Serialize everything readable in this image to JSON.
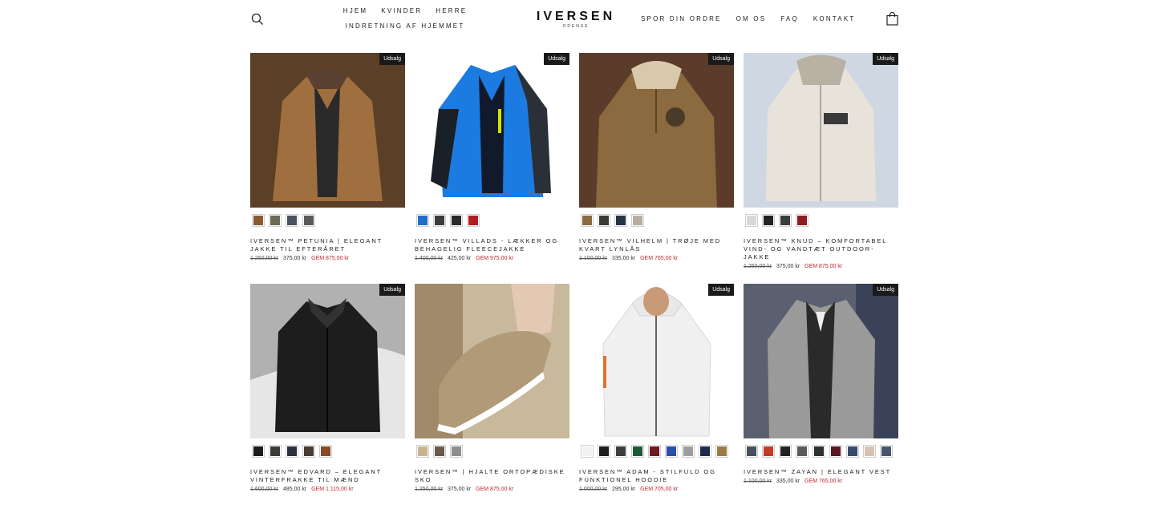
{
  "header": {
    "nav_left": [
      "HJEM",
      "KVINDER",
      "HERRE"
    ],
    "nav_left_row2": "INDRETNING AF HJEMMET",
    "logo": "IVERSEN",
    "logo_sub": "ODENSE",
    "nav_right": [
      "SPOR DIN ORDRE",
      "OM OS",
      "FAQ",
      "KONTAKT"
    ],
    "icons": {
      "search": "search-icon",
      "cart": "shopping-bag-icon"
    }
  },
  "badge_label": "Udsalg",
  "products": [
    {
      "title": "IVERSEN™ PETUNIA | ELEGANT JAKKE TIL EFTERÅRET",
      "old_price": "1.250,00 kr",
      "price": "375,00 kr",
      "save": "GEM 875,00 kr",
      "image": "brown-jacket",
      "swatches": [
        "#8a5a35",
        "#6b6a55",
        "#4b5260",
        "#5a5a5a"
      ]
    },
    {
      "title": "IVERSEN™ VILLADS - LÆKKER OG BEHAGELIG FLEECEJAKKE",
      "old_price": "1.400,00 kr",
      "price": "425,00 kr",
      "save": "GEM 975,00 kr",
      "image": "blue-fleece-jacket",
      "swatches": [
        "#1f6fc8",
        "#3a3d3a",
        "#2b2b2b",
        "#b31c22"
      ]
    },
    {
      "title": "IVERSEN™ VILHELM | TRØJE MED KVART LYNLÅS",
      "old_price": "1.100,00 kr",
      "price": "335,00 kr",
      "save": "GEM 765,00 kr",
      "image": "deer-sweater",
      "swatches": [
        "#8a6a3e",
        "#3c3a34",
        "#253447",
        "#b5ada0"
      ]
    },
    {
      "title": "IVERSEN™ KNUD – KOMFORTABEL VIND- OG VANDTÆT OUTDOOR-JAKKE",
      "old_price": "1.250,00 kr",
      "price": "375,00 kr",
      "save": "GEM 875,00 kr",
      "image": "white-outdoor-jacket",
      "swatches": [
        "#d8d8d8",
        "#222222",
        "#3b3d3e",
        "#8e1c22"
      ]
    },
    {
      "title": "IVERSEN™ EDVARD – ELEGANT VINTERFRAKKE TIL MÆND",
      "old_price": "1.600,00 kr",
      "price": "485,00 kr",
      "save": "GEM 1.115,00 kr",
      "image": "black-coat",
      "swatches": [
        "#1d1d1d",
        "#3a3a3a",
        "#2a3040",
        "#4a3a30",
        "#8a4a25"
      ]
    },
    {
      "title": "IVERSEN™ | HJALTE ORTOPÆDISKE SKO",
      "old_price": "1.250,00 kr",
      "price": "375,00 kr",
      "save": "GEM 875,00 kr",
      "image": "beige-shoes",
      "swatches": [
        "#c9b48e",
        "#6b5a4c",
        "#8e8e8e"
      ]
    },
    {
      "title": "IVERSEN™ ADAM - STILFULD OG FUNKTIONEL HOODIE",
      "old_price": "1.000,00 kr",
      "price": "295,00 kr",
      "save": "GEM 705,00 kr",
      "image": "white-hoodie",
      "swatches": [
        "#f2f2f2",
        "#1e1e1e",
        "#3b3e3b",
        "#1f5a36",
        "#6e1a1e",
        "#2a4fa8",
        "#9e9e9e",
        "#1c2c4a",
        "#9b7a45"
      ]
    },
    {
      "title": "IVERSEN™ ZAYAN | ELEGANT VEST",
      "old_price": "1.100,00 kr",
      "price": "335,00 kr",
      "save": "GEM 765,00 kr",
      "image": "grey-knit-cardigan",
      "swatches": [
        "#4a4f5c",
        "#c43a2a",
        "#222222",
        "#5a5a5a",
        "#2f2f2f",
        "#5a1a22",
        "#3a4a6e",
        "#d6c2b2",
        "#4a5670"
      ]
    }
  ]
}
